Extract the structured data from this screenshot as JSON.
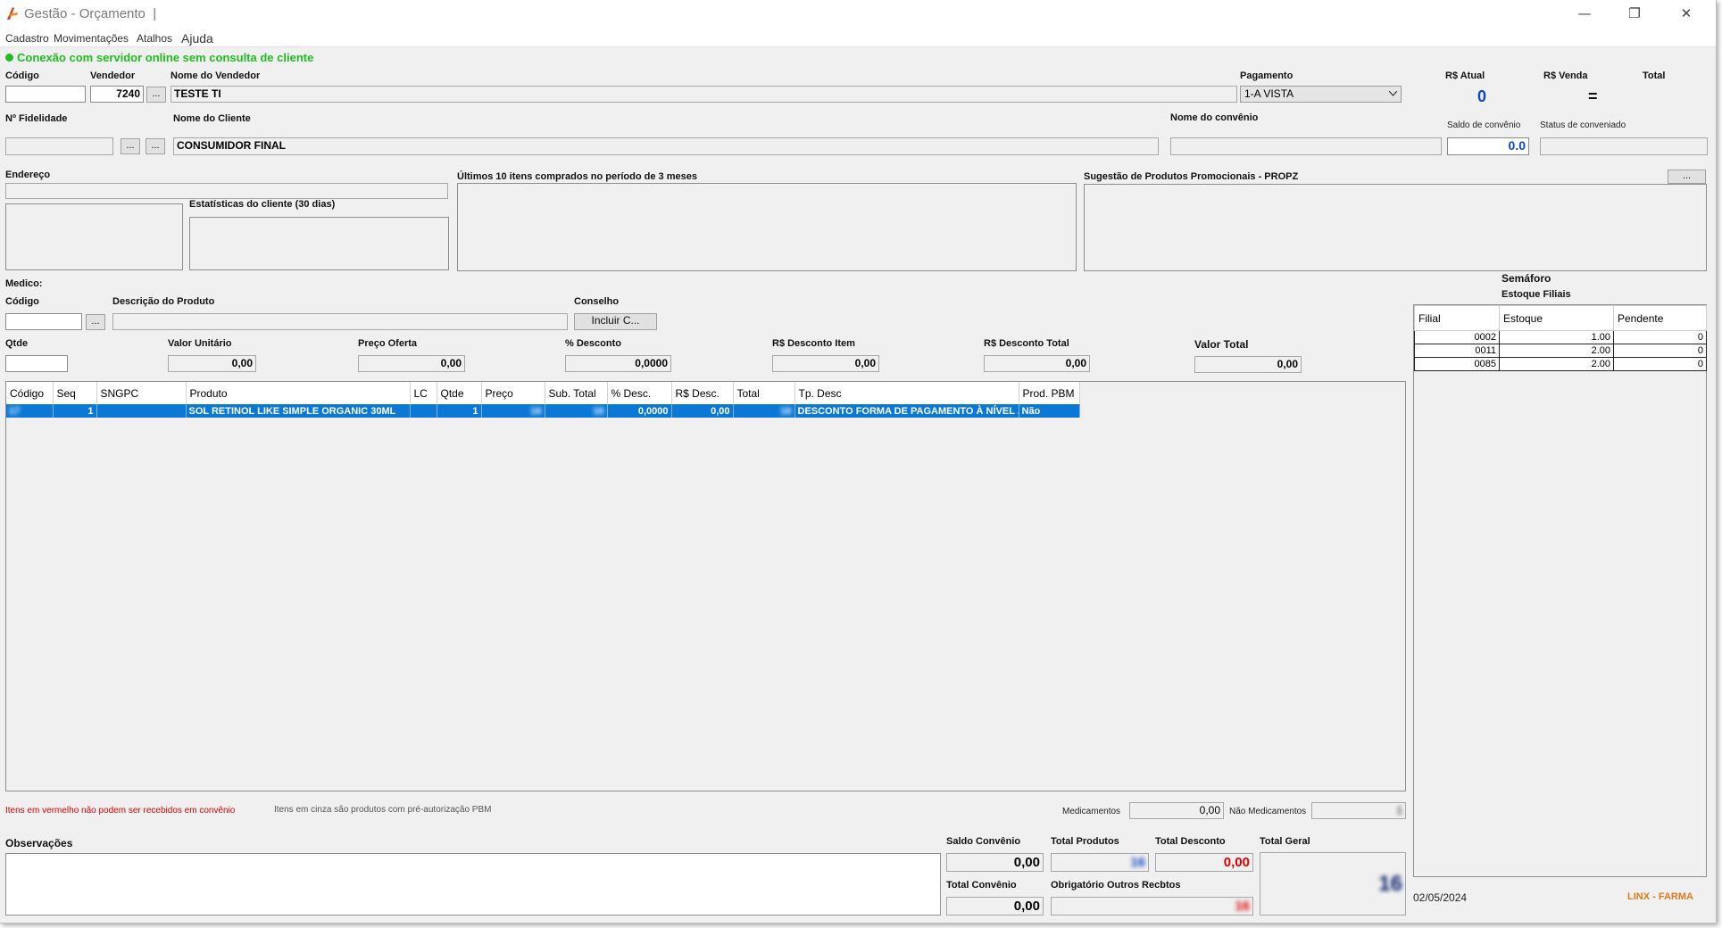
{
  "window": {
    "title": "Gestão - Orçamento",
    "title_sep": "|",
    "controls": {
      "minimize": "—",
      "restore": "❐",
      "close": "✕"
    }
  },
  "menu": [
    "Cadastro",
    "Movimentações",
    "Atalhos",
    "Ajuda"
  ],
  "status": {
    "text": "Conexão com servidor online sem consulta de cliente",
    "color": "#1fbf1f"
  },
  "header": {
    "codigo_label": "Código",
    "codigo_value": "",
    "vendedor_label": "Vendedor",
    "vendedor_value": "7240",
    "nome_vendedor_label": "Nome do Vendedor",
    "nome_vendedor_value": "TESTE TI",
    "pagamento_label": "Pagamento",
    "pagamento_value": "1-A VISTA",
    "rs_atual_label": "R$ Atual",
    "rs_atual_value": "0",
    "rs_venda_label": "R$ Venda",
    "rs_venda_value": "=",
    "total_label": "Total",
    "fidelidade_label": "Nº Fidelidade",
    "fidelidade_value": "",
    "nome_cliente_label": "Nome do Cliente",
    "nome_cliente_value": "CONSUMIDOR FINAL",
    "nome_convenio_label": "Nome do convênio",
    "nome_convenio_value": "",
    "saldo_convenio_label": "Saldo de convênio",
    "saldo_convenio_value": "0.0",
    "status_conveniado_label": "Status de conveniado",
    "status_conveniado_value": "",
    "ellipsis": "..."
  },
  "info": {
    "endereco_label": "Endereço",
    "estatisticas_label": "Estatísticas do cliente  (30 dias)",
    "ultimos_label": "Últimos 10 itens comprados no período de 3 meses",
    "sugestao_label": "Sugestão de Produtos Promocionais - PROPZ"
  },
  "product_entry": {
    "medico_label": "Medico:",
    "codigo_label": "Código",
    "descricao_label": "Descrição do Produto",
    "conselho_label": "Conselho",
    "incluir_label": "Incluir C...",
    "qtde_label": "Qtde",
    "valor_unitario_label": "Valor Unitário",
    "valor_unitario_value": "0,00",
    "preco_oferta_label": "Preço Oferta",
    "preco_oferta_value": "0,00",
    "desconto_pct_label": "% Desconto",
    "desconto_pct_value": "0,0000",
    "desconto_item_label": "R$ Desconto Item",
    "desconto_item_value": "0,00",
    "desconto_total_label": "R$ Desconto Total",
    "desconto_total_value": "0,00",
    "valor_total_label": "Valor Total",
    "valor_total_value": "0,00"
  },
  "items_grid": {
    "columns": [
      "Código",
      "Seq",
      "SNGPC",
      "Produto",
      "LC",
      "Qtde",
      "Preço",
      "Sub. Total",
      "% Desc.",
      "R$ Desc.",
      "Total",
      "Tp. Desc",
      "Prod. PBM"
    ],
    "rows": [
      {
        "codigo": "17",
        "seq": "1",
        "sngpc": "",
        "produto": "SOL RETINOL LIKE SIMPLE ORGANIC 30ML",
        "lc": "",
        "qtde": "1",
        "preco": "16",
        "sub_total": "16",
        "desc_pct": "0,0000",
        "desc_rs": "0,00",
        "total": "16",
        "tp_desc": "DESCONTO FORMA DE PAGAMENTO À NÍVEL ...",
        "prod_pbm": "Não"
      }
    ]
  },
  "semaforo": {
    "title": "Semáforo",
    "subtitle": "Estoque Filiais",
    "columns": [
      "Filial",
      "Estoque",
      "Pendente"
    ],
    "rows": [
      {
        "filial": "0002",
        "estoque": "1.00",
        "pendente": "0"
      },
      {
        "filial": "0011",
        "estoque": "2.00",
        "pendente": "0"
      },
      {
        "filial": "0085",
        "estoque": "2.00",
        "pendente": "0"
      }
    ]
  },
  "legend": {
    "red_text": "Itens em vermelho não podem ser recebidos em convênio",
    "gray_text": "Itens em cinza são produtos com pré-autorização PBM",
    "medicamentos_label": "Medicamentos",
    "medicamentos_value": "0,00",
    "nao_medicamentos_label": "Não Medicamentos",
    "nao_medicamentos_value": "1"
  },
  "footer": {
    "observacoes_label": "Observações",
    "saldo_convenio_label": "Saldo Convênio",
    "saldo_convenio_value": "0,00",
    "total_produtos_label": "Total Produtos",
    "total_produtos_value": "16",
    "total_desconto_label": "Total Desconto",
    "total_desconto_value": "0,00",
    "total_geral_label": "Total Geral",
    "total_geral_value": "16",
    "total_convenio_label": "Total Convênio",
    "total_convenio_value": "0,00",
    "obrigatorio_label": "Obrigatório Outros Recbtos",
    "obrigatorio_value": "16",
    "date": "02/05/2024",
    "brand": "LINX - FARMA"
  },
  "colors": {
    "selection": "#0a78d7",
    "red": "#e00000",
    "blue_value": "#0a44c8",
    "dark_blue": "#0b1f6b",
    "brand_orange": "#e07a1a"
  }
}
